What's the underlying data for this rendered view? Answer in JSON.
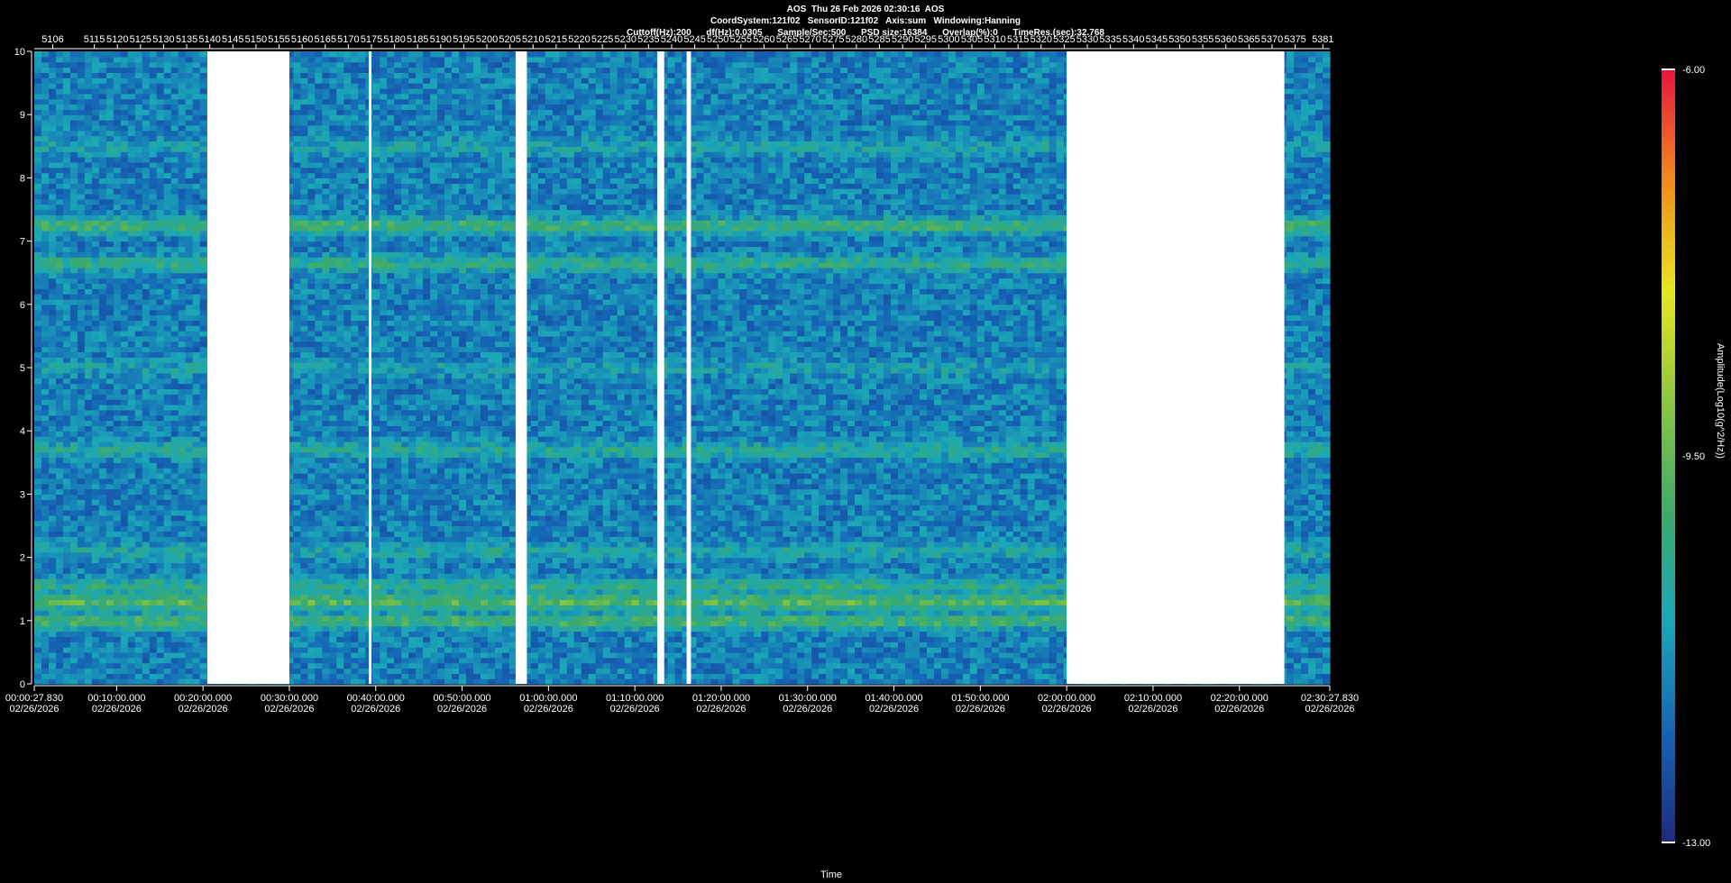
{
  "header": {
    "line1": "AOS  Thu 26 Feb 2026 02:30:16  AOS",
    "line2": "CoordSystem:121f02   SensorID:121f02   Axis:sum   Windowing:Hanning",
    "line3": "Cuttoff(Hz):200      df(Hz):0.0305      Sample/Sec:500      PSD size:16384      Overlap(%):0      TimeRes.(sec):32.768"
  },
  "chart_data": {
    "type": "heatmap",
    "title": "AOS  Thu 26 Feb 2026 02:30:16  AOS",
    "xlabel": "Time",
    "ylabel": "",
    "colorbar_label": "Amplitude(Log10(g^2/Hz))",
    "colorbar_range": [
      -13.0,
      -6.0
    ],
    "colorbar_ticks": [
      "-6.00",
      "-9.50",
      "-13.00"
    ],
    "ylim": [
      0,
      10
    ],
    "y_ticks": [
      "0",
      "1",
      "2",
      "3",
      "4",
      "5",
      "6",
      "7",
      "8",
      "9",
      "10"
    ],
    "top_axis_ticks": [
      "5106",
      "5115",
      "5120",
      "5125",
      "5130",
      "5135",
      "5140",
      "5145",
      "5150",
      "5155",
      "5160",
      "5165",
      "5170",
      "5175",
      "5180",
      "5185",
      "5190",
      "5195",
      "5200",
      "5205",
      "5210",
      "5215",
      "5220",
      "5225",
      "5230",
      "5235",
      "5240",
      "5245",
      "5250",
      "5255",
      "5260",
      "5265",
      "5270",
      "5275",
      "5280",
      "5285",
      "5290",
      "5295",
      "5300",
      "5305",
      "5310",
      "5315",
      "5320",
      "5325",
      "5330",
      "5335",
      "5340",
      "5345",
      "5350",
      "5355",
      "5360",
      "5365",
      "5370",
      "5375",
      "5381"
    ],
    "x_ticks": [
      {
        "time": "00:00:27.830",
        "date": "02/26/2026"
      },
      {
        "time": "00:10:00.000",
        "date": "02/26/2026"
      },
      {
        "time": "00:20:00.000",
        "date": "02/26/2026"
      },
      {
        "time": "00:30:00.000",
        "date": "02/26/2026"
      },
      {
        "time": "00:40:00.000",
        "date": "02/26/2026"
      },
      {
        "time": "00:50:00.000",
        "date": "02/26/2026"
      },
      {
        "time": "01:00:00.000",
        "date": "02/26/2026"
      },
      {
        "time": "01:10:00.000",
        "date": "02/26/2026"
      },
      {
        "time": "01:20:00.000",
        "date": "02/26/2026"
      },
      {
        "time": "01:30:00.000",
        "date": "02/26/2026"
      },
      {
        "time": "01:40:00.000",
        "date": "02/26/2026"
      },
      {
        "time": "01:50:00.000",
        "date": "02/26/2026"
      },
      {
        "time": "02:00:00.000",
        "date": "02/26/2026"
      },
      {
        "time": "02:10:00.000",
        "date": "02/26/2026"
      },
      {
        "time": "02:20:00.000",
        "date": "02/26/2026"
      },
      {
        "time": "02:30:27.830",
        "date": "02/26/2026"
      }
    ],
    "data_gaps_minutes": [
      [
        20.5,
        30.0
      ],
      [
        39.2,
        39.5
      ],
      [
        56.2,
        57.5
      ],
      [
        72.6,
        73.4
      ],
      [
        76.0,
        76.5
      ],
      [
        120.0,
        145.2
      ]
    ],
    "bands": [
      {
        "freq_hz": 1.0,
        "level": -10.0
      },
      {
        "freq_hz": 1.3,
        "level": -9.7
      },
      {
        "freq_hz": 1.55,
        "level": -10.4
      },
      {
        "freq_hz": 2.1,
        "level": -10.8
      },
      {
        "freq_hz": 3.7,
        "level": -10.6
      },
      {
        "freq_hz": 5.0,
        "level": -11.0
      },
      {
        "freq_hz": 6.65,
        "level": -10.4
      },
      {
        "freq_hz": 7.25,
        "level": -10.1
      },
      {
        "freq_hz": 8.5,
        "level": -10.9
      }
    ],
    "background_level": -11.6,
    "colors": {
      "colormap": [
        "#1f2a80",
        "#1565b5",
        "#1ba7b8",
        "#3dab6a",
        "#8cc63f",
        "#e8e622",
        "#f08a1c",
        "#e8143c"
      ],
      "gap": "#ffffff",
      "background": "#000000"
    }
  }
}
